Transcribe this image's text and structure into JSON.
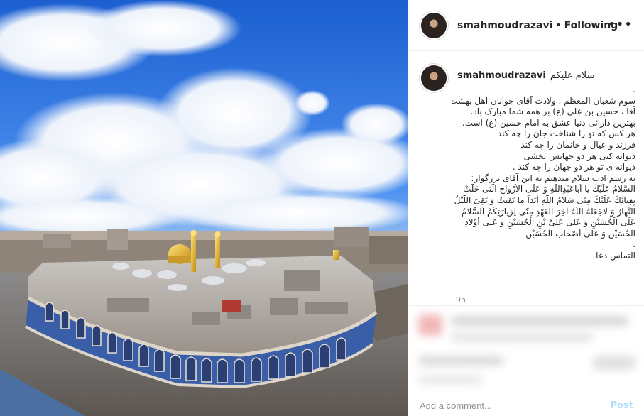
{
  "header": {
    "username": "smahmoudrazavi",
    "separator": "•",
    "follow_status": "Following",
    "more_icon": "more-options-icon",
    "more_label": "•••"
  },
  "caption": {
    "username": "smahmoudrazavi",
    "greeting": "سلام علیکم",
    "lines": [
      ".",
      "سوم شعبان المعظم ، ولادت آقای جوانان اهل بهشت ،",
      "آقا ، حسین بن علی (ع) بر همه شما مبارک باد.",
      "بهترین دارائی دنیا عشق به امام حسین (ع) است.",
      "هر کس که تو را شناخت جان را چه کند",
      "فرزند و عیال و خانمان را چه کند",
      "دیوانه کنی هر دو جهانش بخشی",
      "دیوانه ی تو هر دو جهان را چه کند .",
      "به رسم ادب سلام میدهیم به این آقای بزرگوار:",
      "السَّلامُ عَلَيْكَ يا أَباعَبْدِاللّهِ وَ عَلَى الأَرْواحِ الَّتى حَلَّتْ",
      "بِفِنائِكَ عَلَيْكَ مِنّى سَلامُ اللّهِ أَبَداً ما بَقيتُ وَ بَقِىَ اللَّيْلُ وَ",
      "النَّهارُ وَ لاجَعَلَهُ اللّهُ آخِرَ الْعَهْدِ مِنّى لِزِيارَتِكُمْ اَلسَّلامُ",
      "عَلَى الْحُسَيْنِ وَ عَلى عَلِىِّ بْنِ الْحُسَيْنِ وَ عَلى أَوْلادِ",
      "الْحُسَيْنِ وَ عَلى أَصْحابِ الْحُسَيْنِ",
      ".",
      "التماس دعا"
    ],
    "time": "9h"
  },
  "comment": {
    "placeholder": "Add a comment...",
    "post_label": "Post"
  },
  "colors": {
    "sky": "#2e6fd4",
    "link_disabled": "#b2dffc",
    "border": "#efefef"
  }
}
